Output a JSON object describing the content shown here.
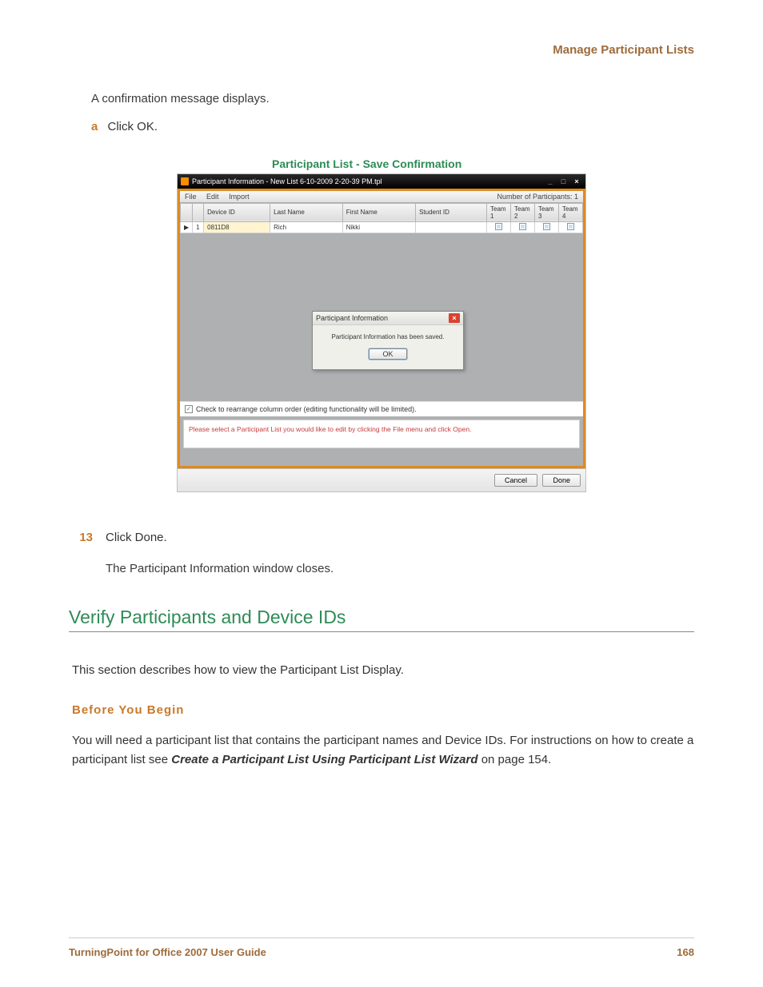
{
  "header": {
    "section_title": "Manage Participant Lists"
  },
  "intro": {
    "confirmation_text": "A confirmation message displays.",
    "substep_letter": "a",
    "substep_text": "Click OK."
  },
  "figure": {
    "caption": "Participant List - Save Confirmation",
    "window_title": "Participant Information - New List 6-10-2009 2-20-39 PM.tpl",
    "menu": {
      "file": "File",
      "edit": "Edit",
      "import": "Import"
    },
    "participants_label": "Number of Participants: 1",
    "columns": {
      "blank1": "",
      "blank2": "",
      "device_id": "Device ID",
      "last_name": "Last Name",
      "first_name": "First Name",
      "student_id": "Student ID",
      "team1": "Team 1",
      "team2": "Team 2",
      "team3": "Team 3",
      "team4": "Team 4"
    },
    "row1": {
      "pointer": "▶",
      "num": "1",
      "device_id": "0811D8",
      "last_name": "Rich",
      "first_name": "Nikki",
      "student_id": ""
    },
    "dialog": {
      "title": "Participant Information",
      "message": "Participant Information has been saved.",
      "ok": "OK"
    },
    "checkbox_label": "Check to rearrange column order (editing functionality will be limited).",
    "info_text": "Please select a Participant List you would like to edit by clicking the File menu and click Open.",
    "buttons": {
      "cancel": "Cancel",
      "done": "Done"
    }
  },
  "step13": {
    "num": "13",
    "text": "Click Done.",
    "after": "The Participant Information window closes."
  },
  "section": {
    "heading": "Verify Participants and Device IDs",
    "intro": "This section describes how to view the Participant List Display.",
    "before_heading": "Before You Begin",
    "before_text_1": "You will need a participant list that contains the participant names and Device IDs. For instructions on how to create a participant list see ",
    "before_link": "Create a Participant List Using Participant List Wizard",
    "before_text_2": " on page 154."
  },
  "footer": {
    "left": "TurningPoint for Office 2007 User Guide",
    "right": "168"
  }
}
